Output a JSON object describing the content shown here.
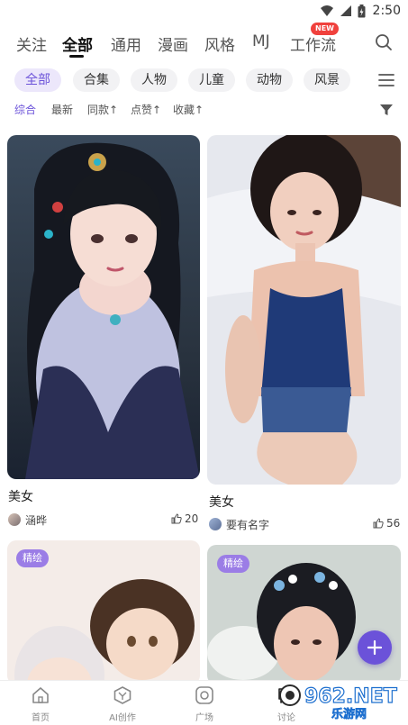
{
  "status_bar": {
    "time": "2:50"
  },
  "top_tabs": [
    "关注",
    "全部",
    "通用",
    "漫画",
    "风格",
    "MJ",
    "工作流"
  ],
  "new_badge": "NEW",
  "category_chips": [
    "全部",
    "合集",
    "人物",
    "儿童",
    "动物",
    "风景"
  ],
  "sort_options": [
    "综合",
    "最新",
    "同款↑",
    "点赞↑",
    "收藏↑"
  ],
  "cards": [
    {
      "title": "美女",
      "author": "涵晔",
      "likes": "20"
    },
    {
      "title": "美女",
      "author": "要有名字",
      "likes": "56"
    },
    {
      "badge": "精绘"
    },
    {
      "badge": "精绘"
    }
  ],
  "bottom_nav": [
    "首页",
    "AI创作",
    "广场",
    "讨论"
  ],
  "watermark": {
    "big": "962.NET",
    "small": "乐游网"
  },
  "icons": [
    "wifi-icon",
    "signal-icon",
    "battery-icon",
    "search-icon",
    "menu-icon",
    "filter-icon",
    "like-icon",
    "plus-icon",
    "home-icon",
    "ai-create-icon",
    "square-icon"
  ],
  "colors": {
    "accent": "#6b52d9",
    "chip_active_bg": "#ece7fb",
    "badge": "#9b7de6",
    "new_badge": "#f0413d"
  }
}
